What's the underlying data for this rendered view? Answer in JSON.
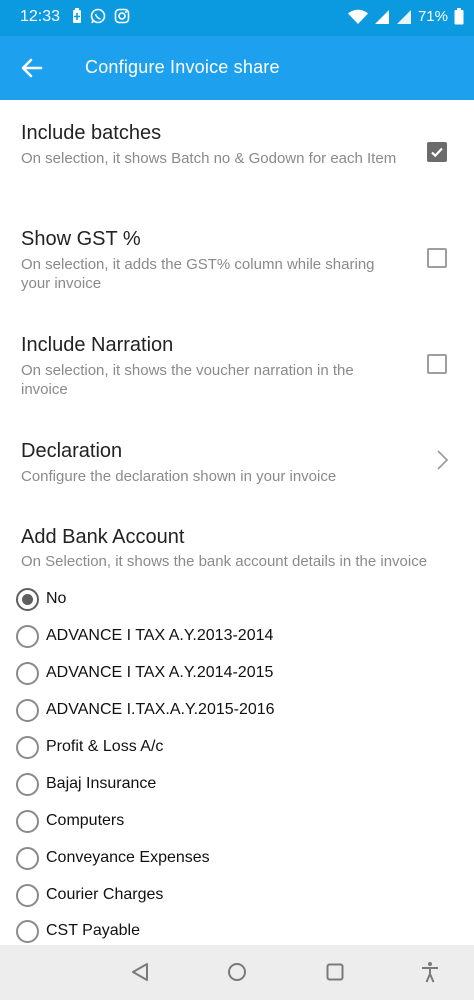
{
  "status_bar": {
    "time": "12:33",
    "battery": "71%",
    "left_icons": [
      "battery-saver-icon",
      "whatsapp-icon",
      "instagram-icon"
    ],
    "right_icons": [
      "wifi-icon",
      "signal-icon",
      "signal-icon",
      "battery-icon"
    ]
  },
  "app_bar": {
    "title": "Configure Invoice share",
    "back_icon": "arrow-left-icon",
    "color": "#1da1ef"
  },
  "settings": [
    {
      "title": "Include batches",
      "description": "On selection, it shows Batch no & Godown for each Item",
      "control": "checkbox",
      "checked": true
    },
    {
      "title": "Show GST %",
      "description": "On selection, it adds the GST% column while sharing your invoice",
      "control": "checkbox",
      "checked": false
    },
    {
      "title": "Include Narration",
      "description": "On selection, it shows the voucher narration in the invoice",
      "control": "checkbox",
      "checked": false
    },
    {
      "title": "Declaration",
      "description": "Configure the declaration shown in your invoice",
      "control": "chevron"
    }
  ],
  "bank_account": {
    "title": "Add Bank Account",
    "description": "On Selection, it shows the bank account details in the invoice",
    "options": [
      {
        "label": "No",
        "selected": true
      },
      {
        "label": "ADVANCE I TAX A.Y.2013-2014",
        "selected": false
      },
      {
        "label": "ADVANCE I TAX A.Y.2014-2015",
        "selected": false
      },
      {
        "label": "ADVANCE I.TAX.A.Y.2015-2016",
        "selected": false
      },
      {
        "label": "Profit & Loss A/c",
        "selected": false
      },
      {
        "label": "Bajaj Insurance",
        "selected": false
      },
      {
        "label": "Computers",
        "selected": false
      },
      {
        "label": "Conveyance Expenses",
        "selected": false
      },
      {
        "label": "Courier Charges",
        "selected": false
      },
      {
        "label": "CST Payable",
        "selected": false
      }
    ]
  },
  "nav_bar": {
    "items": [
      "back-triangle-icon",
      "home-circle-icon",
      "recents-square-icon",
      "accessibility-icon"
    ]
  }
}
